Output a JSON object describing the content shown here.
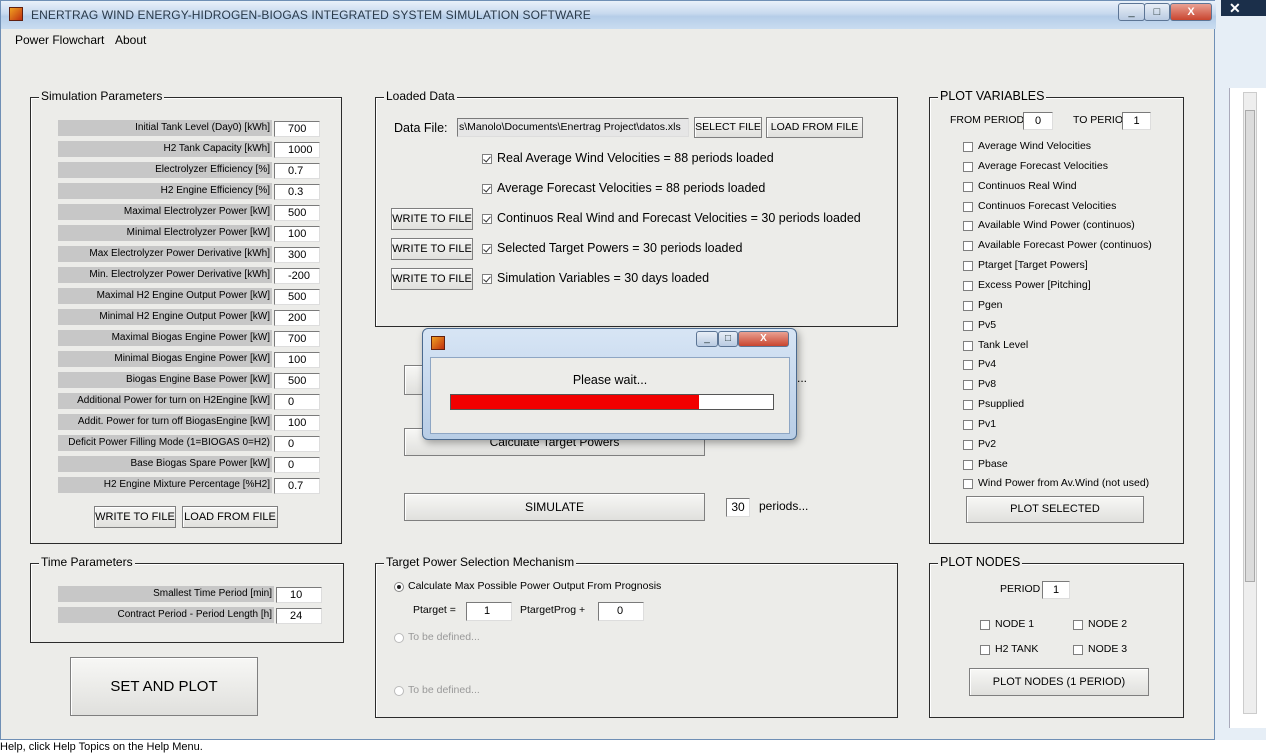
{
  "window": {
    "title": "ENERTRAG WIND ENERGY-HIDROGEN-BIOGAS INTEGRATED SYSTEM SIMULATION SOFTWARE",
    "min_label": "_",
    "max_label": "□",
    "close_label": "X"
  },
  "menu": {
    "items": [
      "Power Flowchart",
      "About"
    ]
  },
  "sim_params": {
    "title": "Simulation Parameters",
    "rows": [
      {
        "label": "Initial Tank Level (Day0) [kWh]",
        "value": "700"
      },
      {
        "label": "H2 Tank Capacity [kWh]",
        "value": "1000"
      },
      {
        "label": "Electrolyzer Efficiency [%]",
        "value": "0.7"
      },
      {
        "label": "H2 Engine Efficiency [%]",
        "value": "0.3"
      },
      {
        "label": "Maximal Electrolyzer Power [kW]",
        "value": "500"
      },
      {
        "label": "Minimal Electrolyzer Power [kW]",
        "value": "100"
      },
      {
        "label": "Max Electrolyzer Power Derivative [kWh]",
        "value": "300"
      },
      {
        "label": "Min. Electrolyzer Power Derivative [kWh]",
        "value": "-200"
      },
      {
        "label": "Maximal H2 Engine Output Power [kW]",
        "value": "500"
      },
      {
        "label": "Minimal H2 Engine Output Power [kW]",
        "value": "200"
      },
      {
        "label": "Maximal Biogas Engine Power [kW]",
        "value": "700"
      },
      {
        "label": "Minimal Biogas Engine Power [kW]",
        "value": "100"
      },
      {
        "label": "Biogas Engine Base Power [kW]",
        "value": "500"
      },
      {
        "label": "Additional Power for turn on H2Engine [kW]",
        "value": "0"
      },
      {
        "label": "Addit. Power for turn off BiogasEngine [kW]",
        "value": "100"
      },
      {
        "label": "Deficit Power Filling Mode (1=BIOGAS 0=H2)",
        "value": "0"
      },
      {
        "label": "Base Biogas Spare Power [kW]",
        "value": "0"
      },
      {
        "label": "H2 Engine Mixture Percentage [%H2]",
        "value": "0.7"
      }
    ],
    "write_btn": "WRITE TO FILE",
    "load_btn": "LOAD FROM FILE"
  },
  "time_params": {
    "title": "Time Parameters",
    "rows": [
      {
        "label": "Smallest Time Period [min]",
        "value": "10"
      },
      {
        "label": "Contract Period - Period Length [h]",
        "value": "24"
      }
    ]
  },
  "set_plot_btn": "SET AND PLOT",
  "loaded_data": {
    "title": "Loaded Data",
    "file_label": "Data File:",
    "file_path": "s\\Manolo\\Documents\\Enertrag Project\\datos.xls",
    "select_btn": "SELECT FILE",
    "load_btn": "LOAD FROM FILE",
    "write_btn": "WRITE TO FILE",
    "items": [
      "Real Average Wind Velocities = 88 periods loaded",
      "Average Forecast Velocities = 88 periods loaded",
      "Continuos Real Wind and Forecast Velocities = 30 periods loaded",
      "Selected Target Powers = 30 periods loaded",
      "Simulation Variables = 30 days loaded"
    ]
  },
  "middle": {
    "hidden_btn_suffix": "s...",
    "calc_btn": "Calculate Target Powers",
    "simulate_btn": "SIMULATE",
    "periods_value": "30",
    "periods_label": "periods..."
  },
  "target_mech": {
    "title": "Target Power Selection Mechanism",
    "option1": "Calculate Max Possible Power Output From Prognosis",
    "ptarget_label": "Ptarget =",
    "ptarget_value": "1",
    "prog_label": "PtargetProg +",
    "prog_value": "0",
    "option2": "To be defined...",
    "option3": "To be defined..."
  },
  "plot_vars": {
    "title": "PLOT VARIABLES",
    "from_label": "FROM PERIOD",
    "from_value": "0",
    "to_label": "TO PERIOD",
    "to_value": "1",
    "items": [
      "Average Wind Velocities",
      "Average Forecast Velocities",
      "Continuos Real Wind",
      "Continuos Forecast Velocities",
      "Available Wind Power (continuos)",
      "Available Forecast Power (continuos)",
      "Ptarget [Target Powers]",
      "Excess Power [Pitching]",
      "Pgen",
      "Pv5",
      "Tank Level",
      "Pv4",
      "Pv8",
      "Psupplied",
      "Pv1",
      "Pv2",
      "Pbase",
      "Wind Power from Av.Wind (not used)"
    ],
    "plot_btn": "PLOT SELECTED"
  },
  "plot_nodes": {
    "title": "PLOT NODES",
    "period_label": "PERIOD",
    "period_value": "1",
    "node1": "NODE 1",
    "node2": "NODE 2",
    "h2tank": "H2 TANK",
    "node3": "NODE 3",
    "plot_btn": "PLOT NODES (1 PERIOD)"
  },
  "dialog": {
    "message": "Please wait...",
    "progress": 0.77,
    "progress_color": "#f20000"
  },
  "statusbar": {
    "text": "Help, click Help Topics on the Help Menu."
  },
  "colors": {
    "label_bg": "#c7c7c7",
    "window_bg": "#ecece9"
  }
}
